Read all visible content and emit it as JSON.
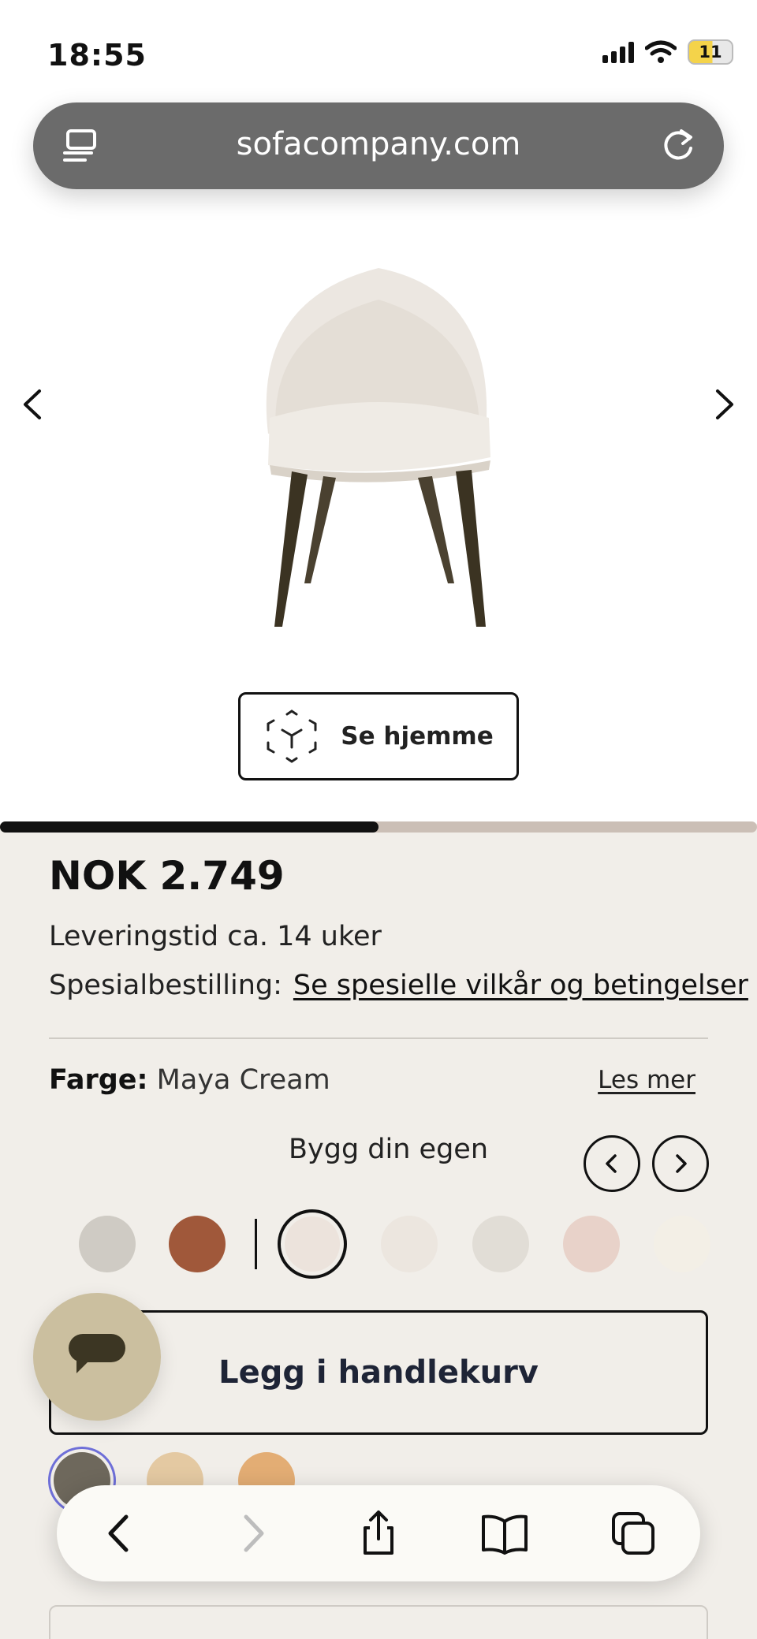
{
  "status_bar": {
    "time": "18:55",
    "battery": "11"
  },
  "browser": {
    "url": "sofacompany.com"
  },
  "product": {
    "ar_label": "Se hjemme",
    "gallery_progress": 0.5,
    "price": "NOK 2.749",
    "delivery": "Leveringstid ca. 14 uker",
    "special_label": "Spesialbestilling:",
    "special_link": "Se spesielle vilkår og betingelser",
    "color_label": "Farge:",
    "color_value": "Maya Cream",
    "read_more": "Les mer",
    "build_label": "Bygg din egen",
    "swatches": [
      {
        "color": "#cfcbc4",
        "selected": false
      },
      {
        "color": "#a0583a",
        "selected": false
      },
      {
        "color": "#ece3dc",
        "selected": true
      },
      {
        "color": "#ece6df",
        "selected": false
      },
      {
        "color": "#e1ddd6",
        "selected": false
      },
      {
        "color": "#e8d2c9",
        "selected": false
      },
      {
        "color": "#f3efe6",
        "selected": false
      }
    ],
    "leg_swatches": [
      "#6e685c",
      "#e4c9a2",
      "#e3ad74"
    ],
    "cart_label": "Legg i handlekurv"
  },
  "colors": {
    "accent": "#111111",
    "chat": "#cbbf9f",
    "background": "#f1eee9"
  },
  "icons": [
    "reader-icon",
    "reload-icon",
    "chevron-left-icon",
    "chevron-right-icon",
    "ar-cube-icon",
    "chat-icon",
    "back-icon",
    "forward-icon",
    "share-icon",
    "bookmarks-icon",
    "tabs-icon"
  ]
}
